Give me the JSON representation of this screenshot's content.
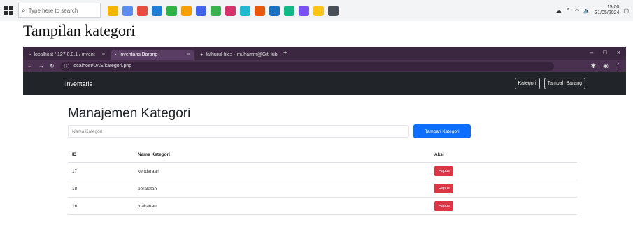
{
  "taskbar": {
    "search_placeholder": "Type here to search",
    "icon_colors": [
      "#f4b400",
      "#5a8dee",
      "#e84e40",
      "#1c7ed6",
      "#2fb344",
      "#f59f00",
      "#4263eb",
      "#37b24d",
      "#d6336c",
      "#22b8cf",
      "#e8590c",
      "#1971c2",
      "#12b886",
      "#7950f2",
      "#fcc419",
      "#495057"
    ],
    "clock_time": "15:00",
    "clock_date": "31/05/2024"
  },
  "caption": "Tampilan kategori",
  "browser": {
    "tabs": [
      {
        "label": "localhost / 127.0.0.1 / invent"
      },
      {
        "label": "Inventaris Barang",
        "active": true
      },
      {
        "label": "fathurul-files · muhamm@GitHub"
      }
    ],
    "url": "localhost/UAS/kategori.php",
    "navbar": {
      "brand": "Inventaris",
      "kategori_button": "Kategori",
      "tambah_barang_button": "Tambah Barang"
    },
    "page": {
      "title": "Manajemen Kategori",
      "input_placeholder": "Nama Kategori",
      "add_button": "Tambah Kategori",
      "table": {
        "headers": [
          "ID",
          "Nama Kategori",
          "Aksi"
        ],
        "rows": [
          {
            "id": "17",
            "name": "kendaraan",
            "action": "Hapus"
          },
          {
            "id": "18",
            "name": "peralatan",
            "action": "Hapus"
          },
          {
            "id": "16",
            "name": "makanan",
            "action": "Hapus"
          }
        ]
      }
    }
  }
}
